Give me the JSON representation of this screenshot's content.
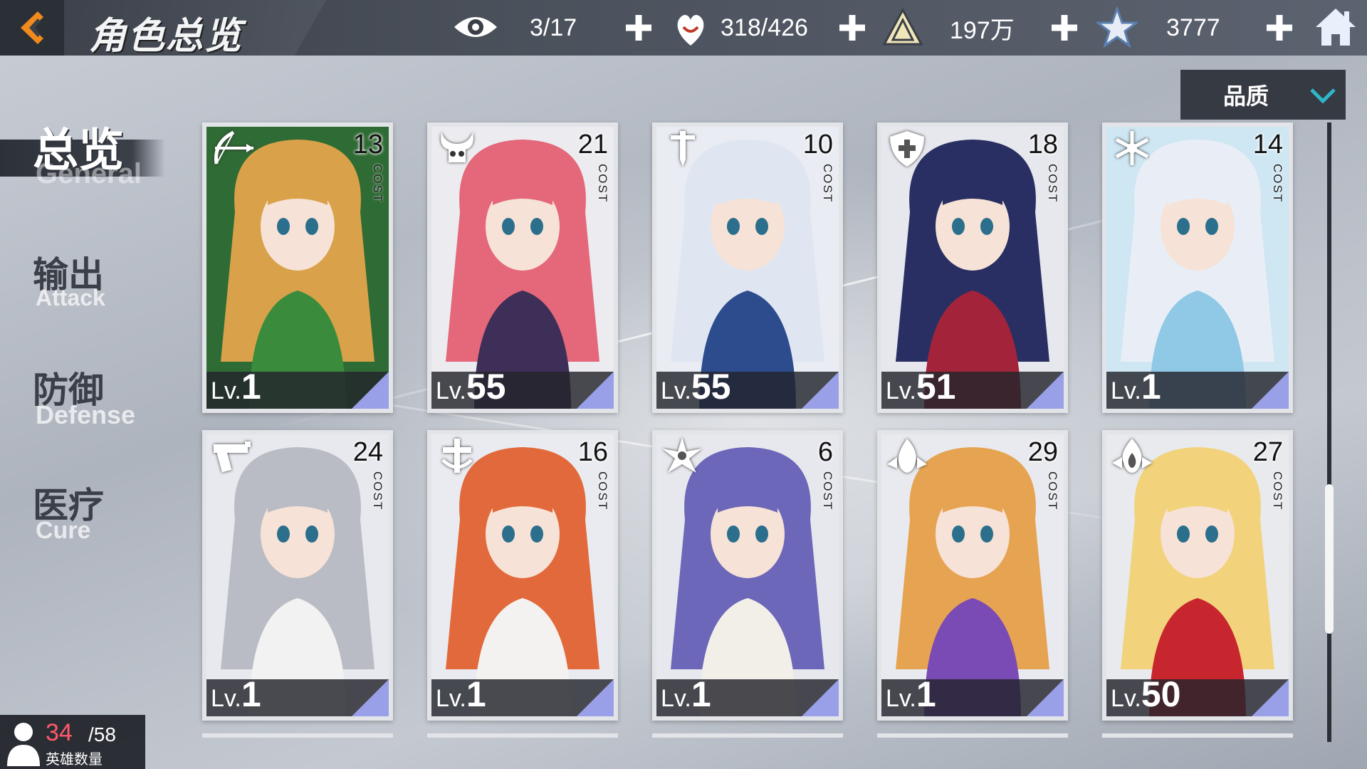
{
  "header": {
    "title": "角色总览",
    "resources": [
      {
        "name": "vision",
        "icon": "eye-icon",
        "value": "3/17"
      },
      {
        "name": "stamina",
        "icon": "heart-hand-icon",
        "value": "318/426"
      },
      {
        "name": "gold",
        "icon": "triangle-crystal-icon",
        "value": "197万"
      },
      {
        "name": "gems",
        "icon": "star-crystal-icon",
        "value": "3777"
      }
    ]
  },
  "nav": {
    "items": [
      {
        "cn": "总览",
        "en": "General",
        "active": true
      },
      {
        "cn": "输出",
        "en": "Attack",
        "active": false
      },
      {
        "cn": "防御",
        "en": "Defense",
        "active": false
      },
      {
        "cn": "医疗",
        "en": "Cure",
        "active": false
      }
    ]
  },
  "sort": {
    "label": "品质"
  },
  "cost_label": "COST",
  "lv_prefix": "Lv.",
  "cards": [
    {
      "cost": "13",
      "lv": "1",
      "class_icon": "bow-icon",
      "hair": "#d9a24a",
      "bg": "#2f6b34",
      "outfit": "#3a8c3c"
    },
    {
      "cost": "21",
      "lv": "55",
      "class_icon": "demon-skull-icon",
      "hair": "#e4677a",
      "bg": "#ecebef",
      "outfit": "#3d2f57"
    },
    {
      "cost": "10",
      "lv": "55",
      "class_icon": "sword-icon",
      "hair": "#dfe6f2",
      "bg": "#e9ecf2",
      "outfit": "#2d4c8e"
    },
    {
      "cost": "18",
      "lv": "51",
      "class_icon": "shield-icon",
      "hair": "#2a2f63",
      "bg": "#e7e8ee",
      "outfit": "#a3243a"
    },
    {
      "cost": "14",
      "lv": "1",
      "class_icon": "snowflake-icon",
      "hair": "#e9eef6",
      "bg": "#cfe7f3",
      "outfit": "#8fc9e6"
    },
    {
      "cost": "24",
      "lv": "1",
      "class_icon": "gun-icon",
      "hair": "#b9bcc4",
      "bg": "#e7e9ee",
      "outfit": "#f2f2f2"
    },
    {
      "cost": "16",
      "lv": "1",
      "class_icon": "cross-icon",
      "hair": "#e2693b",
      "bg": "#e9ebf0",
      "outfit": "#f4f1f1"
    },
    {
      "cost": "6",
      "lv": "1",
      "class_icon": "shuriken-icon",
      "hair": "#6c67b9",
      "bg": "#e7e8ee",
      "outfit": "#f2efe9"
    },
    {
      "cost": "29",
      "lv": "1",
      "class_icon": "flame-icon",
      "hair": "#e6a452",
      "bg": "#e9eaef",
      "outfit": "#7a4bb4"
    },
    {
      "cost": "27",
      "lv": "50",
      "class_icon": "fire-icon",
      "hair": "#f2d27a",
      "bg": "#e8eaee",
      "outfit": "#c8262e"
    }
  ],
  "hero_count": {
    "owned": "34",
    "total": "/58",
    "label": "英雄数量"
  }
}
